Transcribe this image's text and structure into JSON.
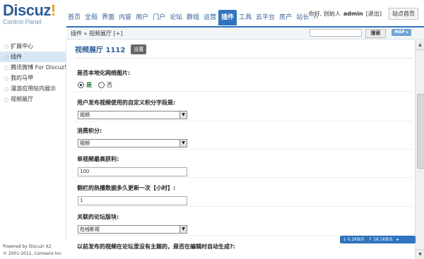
{
  "logo": {
    "main": "Discuz",
    "mark": "!",
    "sub": "Control Panel"
  },
  "nav": {
    "items": [
      "首页",
      "全局",
      "界面",
      "内容",
      "用户",
      "门户",
      "论坛",
      "群组",
      "运营",
      "插件",
      "工具",
      "云平台",
      "房产",
      "站长",
      "››"
    ],
    "active_index": 9
  },
  "topright": {
    "greeting": "你好, 创始人",
    "user": "admin",
    "logout": "[退出]",
    "home_button": "站点首页"
  },
  "subbar": {
    "breadcrumb": "插件 » 视频展厅 [+]",
    "search_button": "搜索",
    "map_button": "MAP ▸"
  },
  "sidebar": {
    "items": [
      "扩展中心",
      "插件",
      "腾讯微博 For Discuz!",
      "我的马甲",
      "漫游应用帖内展示",
      "视频展厅"
    ],
    "active_index": 1
  },
  "footer": {
    "line1": "Powered by Discuz! X2",
    "line2": "© 2001-2011, Comsenz Inc."
  },
  "main": {
    "plugin_title": "视频展厅 1112",
    "settings_tag": "设置",
    "fields": [
      {
        "label": "是否本地化网络图片:",
        "type": "radio",
        "options": [
          "是",
          "否"
        ],
        "selected": 0
      },
      {
        "label": "用户发布视频使用的自定义积分字段是:",
        "type": "select",
        "value": "视频"
      },
      {
        "label": "消费积分:",
        "type": "select",
        "value": "视频"
      },
      {
        "label": "单视频最高获利:",
        "type": "text",
        "value": "100"
      },
      {
        "label": "侧栏的热播数据多久更新一次【小时】:",
        "type": "text",
        "value": "1"
      },
      {
        "label": "关联的论坛版块:",
        "type": "select",
        "value": "在线影视"
      },
      {
        "label": "以前发布的视频在论坛里没有主题的，是否在编辑时自动生成?:",
        "type": "none"
      }
    ]
  },
  "netspeed": {
    "down": "↓ 0.2KB/S",
    "up": "↑ 16.1KB/S",
    "extra": "▸"
  },
  "colors": {
    "accent": "#2f74bd",
    "brand": "#2b5e98"
  }
}
